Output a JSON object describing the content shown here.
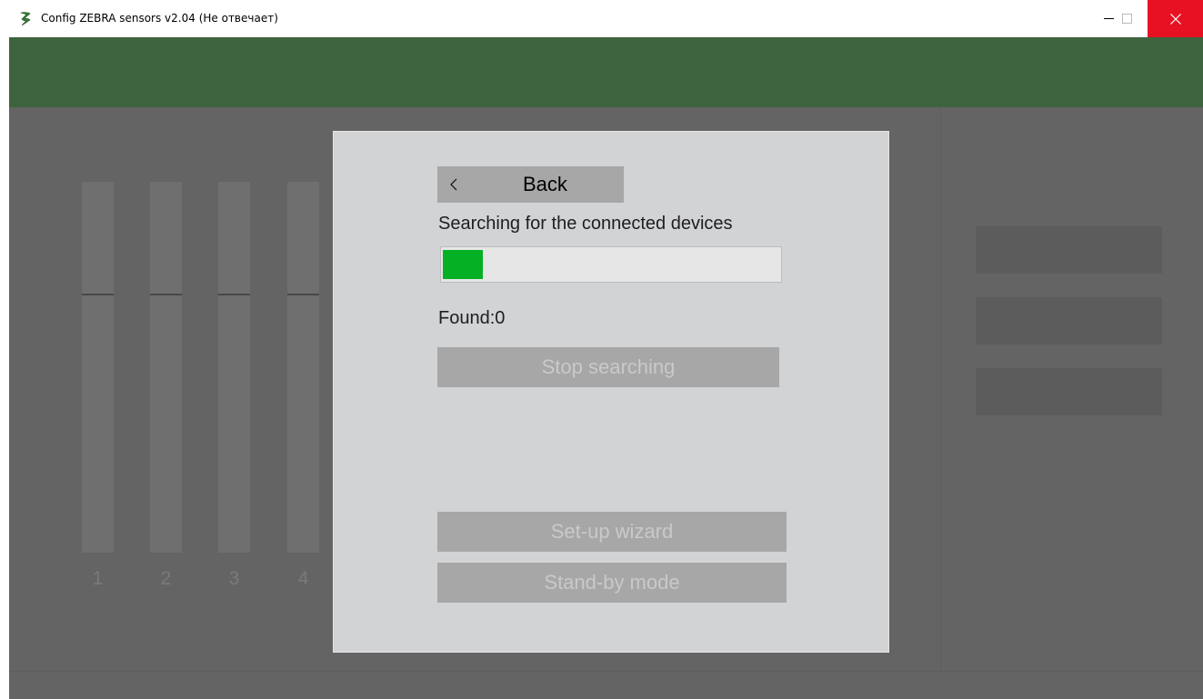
{
  "window": {
    "title": "Config ZEBRA sensors v2.04 (Не отвечает)",
    "app_icon": "zebra-logo-icon"
  },
  "sliders": [
    {
      "label": "1"
    },
    {
      "label": "2"
    },
    {
      "label": "3"
    },
    {
      "label": "4"
    }
  ],
  "dialog": {
    "back_chevron": "<",
    "back_label": "Back",
    "search_label": "Searching for the connected devices",
    "progress": 0.12,
    "found_label": "Found:0",
    "stop_label": "Stop searching",
    "wizard_label": "Set-up wizard",
    "standby_label": "Stand-by mode"
  },
  "colors": {
    "header": "#3e643e",
    "background": "#646464",
    "dialog": "#d2d3d5",
    "progress_fill": "#06b025",
    "close_button": "#e81123"
  }
}
